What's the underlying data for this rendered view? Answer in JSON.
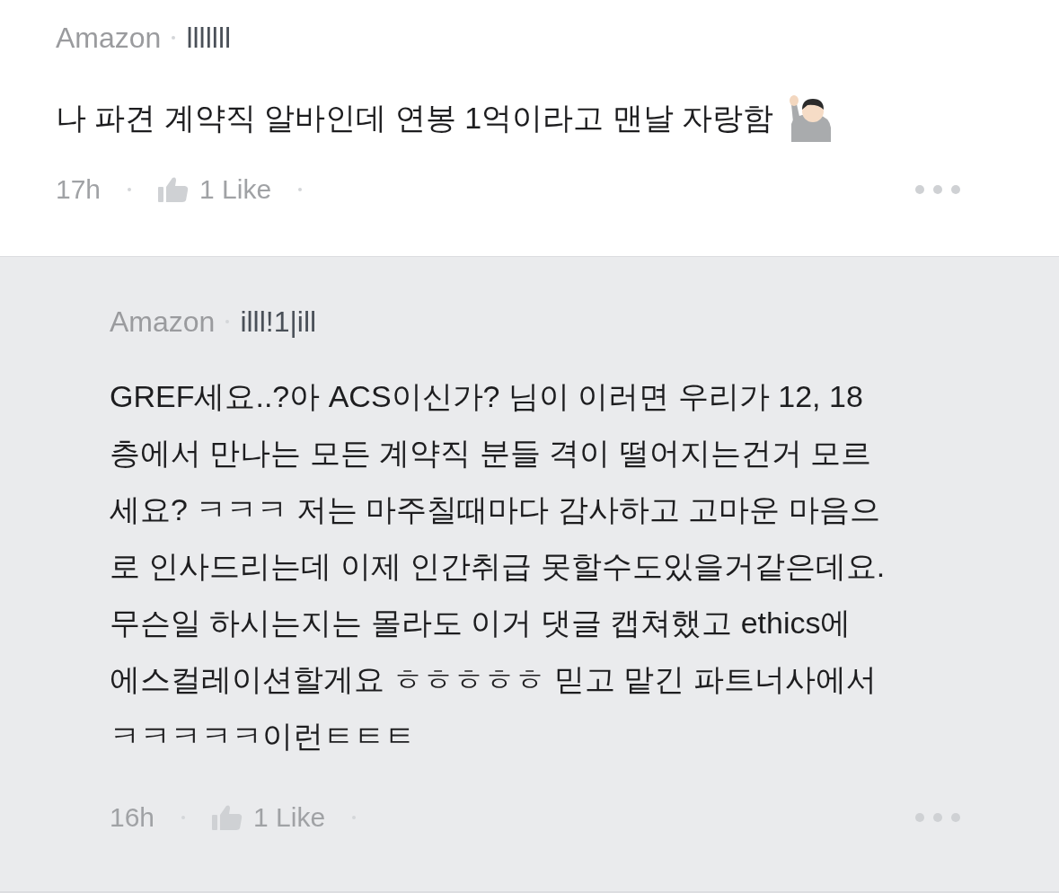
{
  "comments": [
    {
      "kind": "post",
      "company": "Amazon",
      "nickname": "lllllll",
      "body": "나 파견 계약직 알바인데 연봉 1억이라고 맨날 자랑함",
      "time": "17h",
      "likes": "1 Like",
      "liked": false
    },
    {
      "kind": "reply",
      "company": "Amazon",
      "nickname": "illl!1|ill",
      "body": "GREF세요..?아 ACS이신가? 님이 이러면 우리가 12, 18\n층에서 만나는 모든 계약직 분들 격이 떨어지는건거 모르\n세요? ㅋㅋㅋ 저는 마주칠때마다 감사하고 고마운 마음으\n로 인사드리는데 이제 인간취급 못할수도있을거같은데요.\n무슨일 하시는지는 몰라도 이거 댓글 캡쳐했고 ethics에\n에스컬레이션할게요 ㅎㅎㅎㅎㅎ 믿고 맡긴 파트너사에서\nㅋㅋㅋㅋㅋ이런ㅌㅌㅌ",
      "time": "16h",
      "likes": "1 Like",
      "liked": false
    }
  ]
}
